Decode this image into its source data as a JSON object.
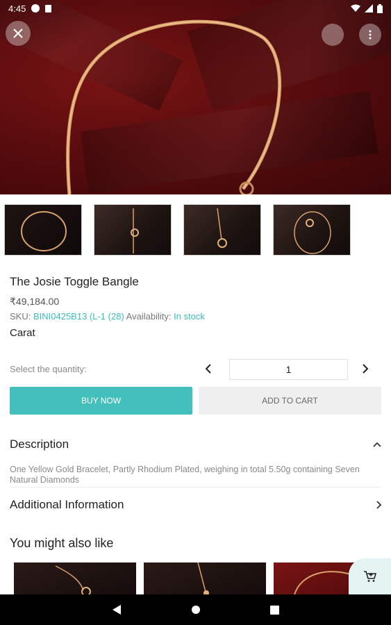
{
  "status_bar": {
    "time": "4:45",
    "icons": [
      "google-icon",
      "sim-icon",
      "wifi-icon",
      "signal-icon",
      "battery-icon"
    ]
  },
  "hero": {
    "close_icon": "close-icon",
    "share_icon": "circle-button",
    "menu_icon": "more-vert-icon"
  },
  "thumbnails": [
    "thumb-1",
    "thumb-2",
    "thumb-3",
    "thumb-4"
  ],
  "product": {
    "title": "The Josie Toggle Bangle",
    "price": "₹49,184.00",
    "sku_label": "SKU:",
    "sku_value": "BINI0425B13 (L-1 (28)",
    "availability_label": "Availability:",
    "availability_value": "In stock",
    "carat": "Carat"
  },
  "quantity": {
    "label": "Select the quantity:",
    "value": "1",
    "prev_icon": "chevron-left-icon",
    "next_icon": "chevron-right-icon"
  },
  "buttons": {
    "buy_now": "BUY NOW",
    "add_to_cart": "ADD TO CART"
  },
  "description": {
    "heading": "Description",
    "text": "One Yellow Gold Bracelet, Partly Rhodium Plated, weighing in total 5.50g containing Seven Natural Diamonds"
  },
  "additional": {
    "heading": "Additional Information"
  },
  "recommendations": {
    "heading": "You might also like"
  },
  "colors": {
    "accent": "#43c0bb",
    "link": "#3bbdb8",
    "hero_bg": "#5a0c0e"
  }
}
